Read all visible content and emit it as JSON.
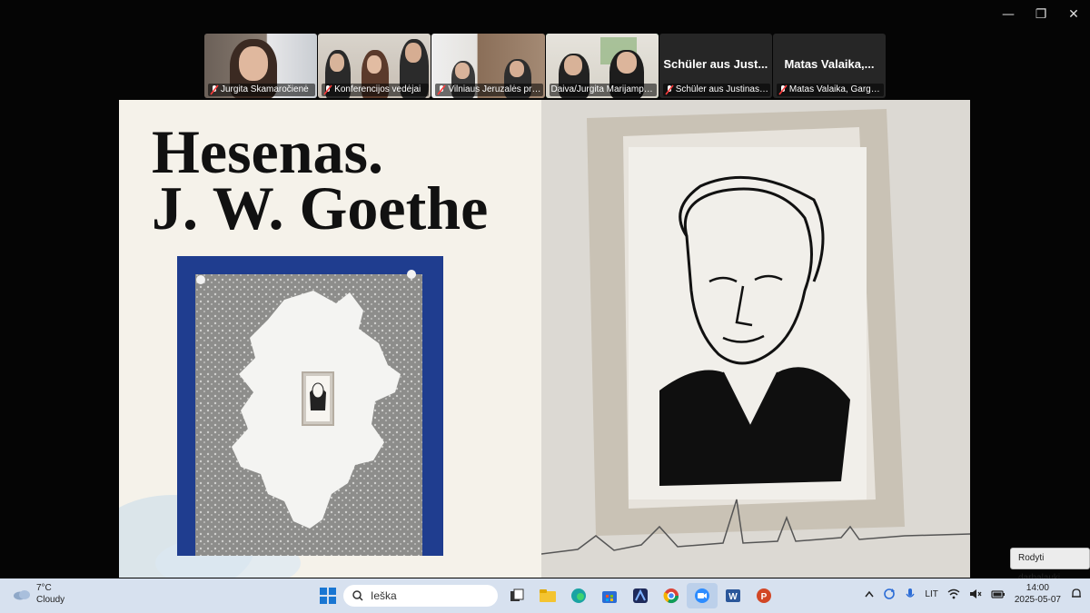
{
  "window_controls": {
    "minimize": "—",
    "restore": "❐",
    "close": "✕"
  },
  "participants": [
    {
      "caption": "Jurgita Skamaročienė",
      "big_name": ""
    },
    {
      "caption": "Konferencijos vedėjai",
      "big_name": ""
    },
    {
      "caption": "Vilniaus Jeruzalės prog...",
      "big_name": ""
    },
    {
      "caption": "Daiva/Jurgita Marijampol...",
      "big_name": ""
    },
    {
      "caption": "Schüler aus Justinas-V...",
      "big_name": "Schüler aus Just..."
    },
    {
      "caption": "Matas Valaika, Gargžd...",
      "big_name": "Matas Valaika,..."
    }
  ],
  "slide": {
    "title_line1": "Hesenas.",
    "title_line2": "J. W. Goethe"
  },
  "tooltip": "Rodyti darbalaukį",
  "taskbar": {
    "weather_temp": "7°C",
    "weather_desc": "Cloudy",
    "search_placeholder": "Ieška",
    "apps": [
      "windows-start-icon",
      "task-view-icon",
      "file-explorer-icon",
      "edge-icon",
      "store-icon",
      "copilot-icon",
      "chrome-icon",
      "zoom-icon",
      "word-icon",
      "powerpoint-icon"
    ],
    "language": "LIT",
    "time": "14:00",
    "date": "2025-05-07"
  },
  "colors": {
    "active_speaker": "#2fd36a",
    "taskbar_bg": "#d7e1ef",
    "slide_bg": "#f5f2ea"
  }
}
